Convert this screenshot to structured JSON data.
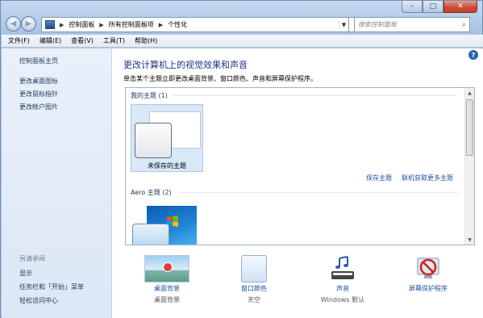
{
  "window": {
    "controls": [
      "–",
      "□",
      "✕"
    ]
  },
  "nav": {
    "breadcrumbs": [
      "控制面板",
      "所有控制面板项",
      "个性化"
    ],
    "search_placeholder": "搜索控制面板"
  },
  "menu": {
    "items": [
      "文件(F)",
      "编辑(E)",
      "查看(V)",
      "工具(T)",
      "帮助(H)"
    ]
  },
  "sidebar": {
    "home": "控制面板主页",
    "links": [
      "更改桌面图标",
      "更改鼠标指针",
      "更改帐户图片"
    ],
    "see_also_label": "另请参阅",
    "see_also": [
      "显示",
      "任务栏和「开始」菜单",
      "轻松访问中心"
    ]
  },
  "main": {
    "title": "更改计算机上的视觉效果和声音",
    "subtitle": "单击某个主题立即更改桌面背景、窗口颜色、声音和屏幕保护程序。",
    "my_themes_header": "我的主题 (1)",
    "unsaved_theme": "未保存的主题",
    "save_theme": "保存主题",
    "get_more_themes": "联机获取更多主题",
    "aero_header": "Aero 主题 (2)"
  },
  "bottom": [
    {
      "link": "桌面背景",
      "value": "桌面背景",
      "icon": "desktop-background-icon"
    },
    {
      "link": "窗口颜色",
      "value": "天空",
      "icon": "window-color-icon"
    },
    {
      "link": "声音",
      "value": "Windows 默认",
      "icon": "sound-icon"
    },
    {
      "link": "屏幕保护程序",
      "value": "",
      "icon": "screensaver-icon"
    }
  ],
  "colors": {
    "title_blue": "#1e3287",
    "link_blue": "#1e4f9b",
    "sidebar_bg": "#e2ebf7",
    "close_red": "#c74a33"
  }
}
